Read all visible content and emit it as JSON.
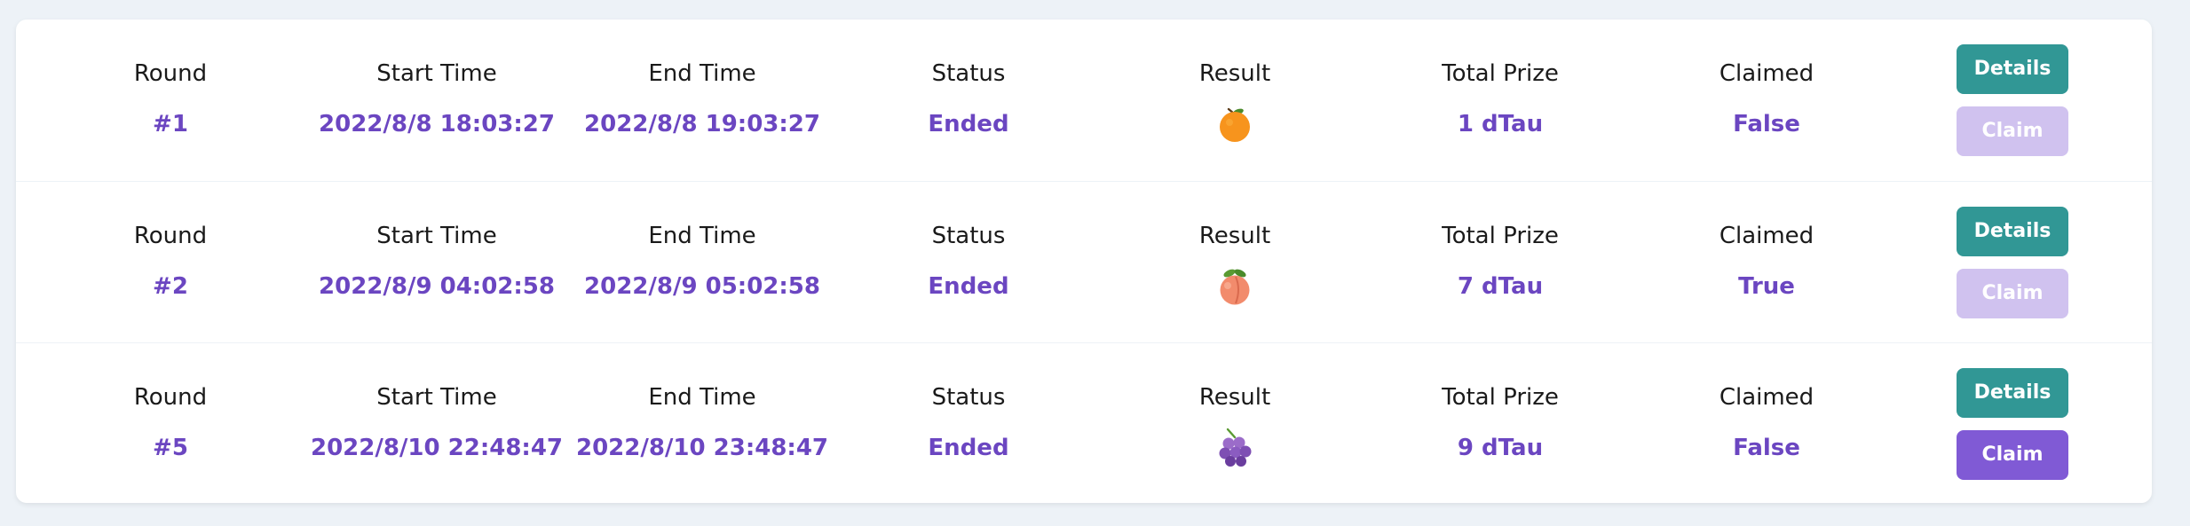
{
  "labels": {
    "round": "Round",
    "start_time": "Start Time",
    "end_time": "End Time",
    "status": "Status",
    "result": "Result",
    "total_prize": "Total Prize",
    "claimed": "Claimed"
  },
  "buttons": {
    "details": "Details",
    "claim": "Claim"
  },
  "colors": {
    "page_bg": "#edf2f7",
    "value_text": "#6b46c1",
    "details_button": "#319795",
    "claim_button": "#805ad5",
    "claim_button_disabled": "#d0c2ef"
  },
  "rounds": [
    {
      "round": "#1",
      "start_time": "2022/8/8 18:03:27",
      "end_time": "2022/8/8 19:03:27",
      "status": "Ended",
      "result_icon": "orange-icon",
      "total_prize": "1 dTau",
      "claimed": "False",
      "claim_enabled": false
    },
    {
      "round": "#2",
      "start_time": "2022/8/9 04:02:58",
      "end_time": "2022/8/9 05:02:58",
      "status": "Ended",
      "result_icon": "peach-icon",
      "total_prize": "7 dTau",
      "claimed": "True",
      "claim_enabled": false
    },
    {
      "round": "#5",
      "start_time": "2022/8/10 22:48:47",
      "end_time": "2022/8/10 23:48:47",
      "status": "Ended",
      "result_icon": "grapes-icon",
      "total_prize": "9 dTau",
      "claimed": "False",
      "claim_enabled": true
    }
  ]
}
